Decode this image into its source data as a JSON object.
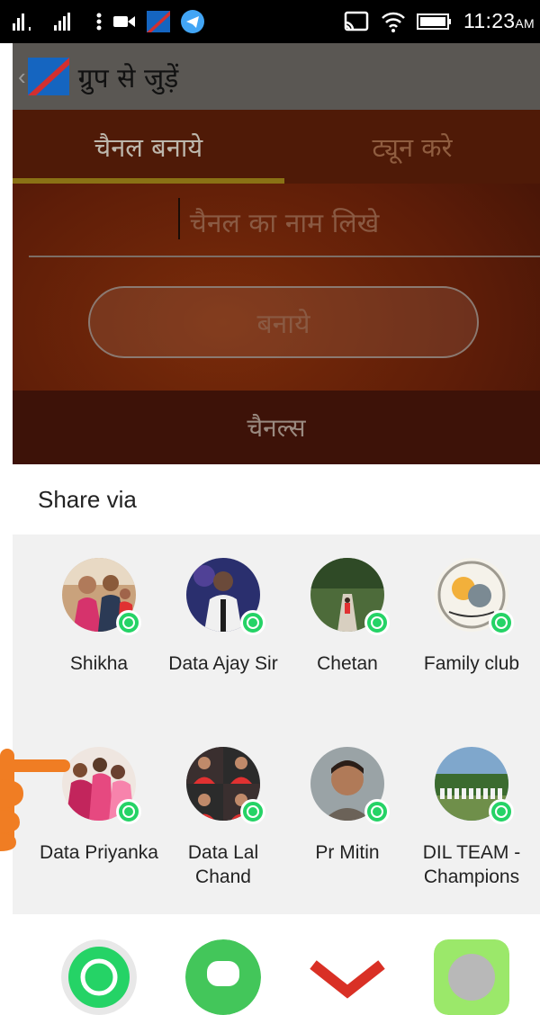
{
  "status_bar": {
    "time": "11:23",
    "ampm": "AM"
  },
  "app_bar": {
    "title": "ग्रुप से जुड़ें"
  },
  "tabs": [
    {
      "label": "चैनल बनाये",
      "selected": true
    },
    {
      "label": "ट्यून करे",
      "selected": false
    }
  ],
  "channel_form": {
    "name_placeholder": "चैनल का नाम लिखे",
    "create_label": "बनाये"
  },
  "channels_label": "चैनल्स",
  "share_sheet": {
    "title": "Share via",
    "targets": [
      {
        "name": "Shikha"
      },
      {
        "name": "Data Ajay Sir"
      },
      {
        "name": "Chetan"
      },
      {
        "name": "Family club"
      },
      {
        "name": "Data Priyanka"
      },
      {
        "name": "Data Lal Chand"
      },
      {
        "name": "Pr Mitin"
      },
      {
        "name": "DIL TEAM - Champions"
      }
    ],
    "apps": [
      {
        "icon": "whatsapp-icon"
      },
      {
        "icon": "hangouts-icon"
      },
      {
        "icon": "gmail-icon"
      },
      {
        "icon": "messages-icon"
      }
    ]
  },
  "colors": {
    "whatsapp_green": "#25d366",
    "tab_indicator": "#8a7215",
    "overlay_brown": "#5e1d08",
    "hand_orange": "#f07d23"
  }
}
